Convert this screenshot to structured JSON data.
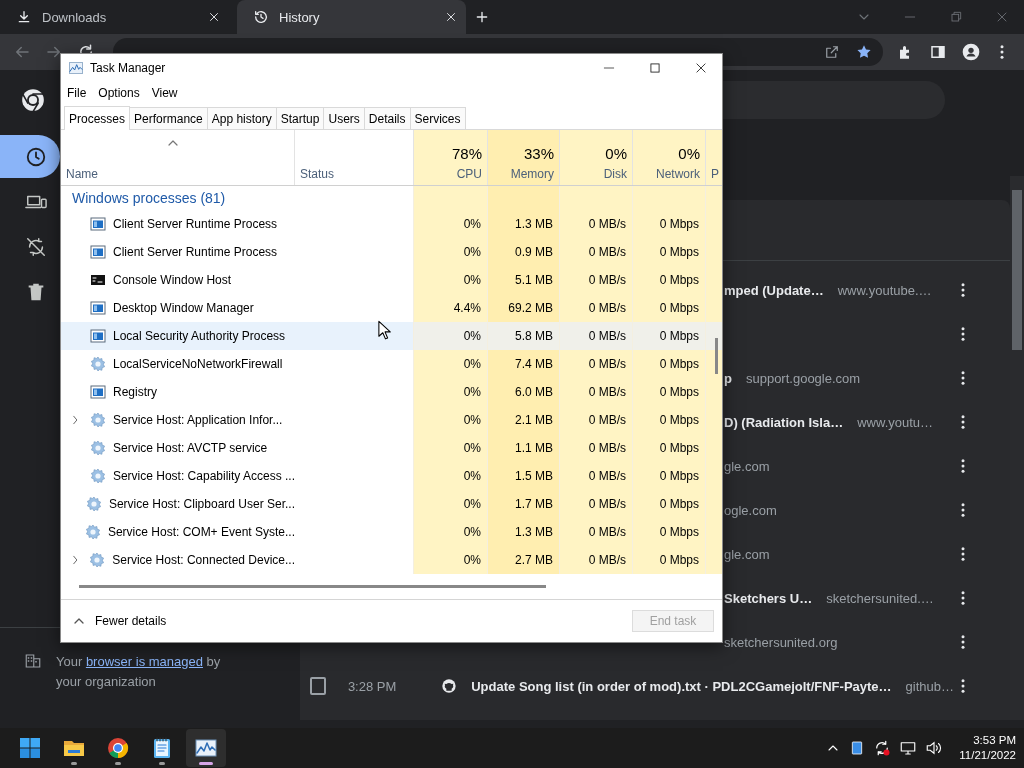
{
  "browser": {
    "tabs": [
      {
        "kind": "download",
        "label": "Downloads",
        "selected": false
      },
      {
        "kind": "history",
        "label": "History",
        "selected": true
      }
    ],
    "sidebar": {
      "items": [
        {
          "kind": "history",
          "selected": true
        },
        {
          "kind": "devices",
          "selected": false
        },
        {
          "kind": "sync-off",
          "selected": false
        },
        {
          "kind": "trash",
          "selected": false
        }
      ],
      "managed_note": {
        "before": "Your",
        "link": "browser is managed",
        "after": "by your organization"
      }
    },
    "history_rows": [
      {
        "title": "mped (Update…",
        "url": "www.youtube.…"
      },
      {},
      {
        "title": "p",
        "url": "support.google.com"
      },
      {
        "title": "D) (Radiation Isla…",
        "url": "www.youtu…"
      },
      {
        "url": "gle.com"
      },
      {
        "url": "ogle.com"
      },
      {
        "url": "gle.com"
      },
      {
        "title": "Sketchers U…",
        "url": "sketchersunited.…"
      },
      {
        "url": "sketchersunited.org"
      },
      {
        "checked": false,
        "time": "3:28 PM",
        "title": "Update Song list (in order of mod).txt · PDL2CGamejolt/FNF-Payte…",
        "url": "github…"
      }
    ]
  },
  "task_manager": {
    "title": "Task Manager",
    "menu": [
      "File",
      "Options",
      "View"
    ],
    "tabs": [
      {
        "label": "Processes",
        "selected": true
      },
      {
        "label": "Performance",
        "selected": false
      },
      {
        "label": "App history",
        "selected": false
      },
      {
        "label": "Startup",
        "selected": false
      },
      {
        "label": "Users",
        "selected": false
      },
      {
        "label": "Details",
        "selected": false
      },
      {
        "label": "Services",
        "selected": false
      }
    ],
    "columns": [
      {
        "label": "Name"
      },
      {
        "label": "Status"
      },
      {
        "label": "CPU",
        "total": "78%"
      },
      {
        "label": "Memory",
        "total": "33%"
      },
      {
        "label": "Disk",
        "total": "0%"
      },
      {
        "label": "Network",
        "total": "0%"
      },
      {
        "label": "P"
      }
    ],
    "group": "Windows processes (81)",
    "processes": [
      {
        "kind": "app",
        "name": "Client Server Runtime Process",
        "expandable": false,
        "selected": false,
        "cpu": "0%",
        "memory": "1.3 MB",
        "disk": "0 MB/s",
        "network": "0 Mbps"
      },
      {
        "kind": "app",
        "name": "Client Server Runtime Process",
        "expandable": false,
        "selected": false,
        "cpu": "0%",
        "memory": "0.9 MB",
        "disk": "0 MB/s",
        "network": "0 Mbps"
      },
      {
        "kind": "console",
        "name": "Console Window Host",
        "expandable": false,
        "selected": false,
        "cpu": "0%",
        "memory": "5.1 MB",
        "disk": "0 MB/s",
        "network": "0 Mbps"
      },
      {
        "kind": "app",
        "name": "Desktop Window Manager",
        "expandable": false,
        "selected": false,
        "cpu": "4.4%",
        "memory": "69.2 MB",
        "disk": "0 MB/s",
        "network": "0 Mbps"
      },
      {
        "kind": "app",
        "name": "Local Security Authority Process",
        "expandable": false,
        "selected": true,
        "cpu": "0%",
        "memory": "5.8 MB",
        "disk": "0 MB/s",
        "network": "0 Mbps"
      },
      {
        "kind": "service",
        "name": "LocalServiceNoNetworkFirewall",
        "expandable": false,
        "selected": false,
        "cpu": "0%",
        "memory": "7.4 MB",
        "disk": "0 MB/s",
        "network": "0 Mbps"
      },
      {
        "kind": "app",
        "name": "Registry",
        "expandable": false,
        "selected": false,
        "cpu": "0%",
        "memory": "6.0 MB",
        "disk": "0 MB/s",
        "network": "0 Mbps"
      },
      {
        "kind": "service",
        "name": "Service Host: Application Infor...",
        "expandable": true,
        "selected": false,
        "cpu": "0%",
        "memory": "2.1 MB",
        "disk": "0 MB/s",
        "network": "0 Mbps"
      },
      {
        "kind": "service",
        "name": "Service Host: AVCTP service",
        "expandable": false,
        "selected": false,
        "cpu": "0%",
        "memory": "1.1 MB",
        "disk": "0 MB/s",
        "network": "0 Mbps"
      },
      {
        "kind": "service",
        "name": "Service Host: Capability Access ...",
        "expandable": false,
        "selected": false,
        "cpu": "0%",
        "memory": "1.5 MB",
        "disk": "0 MB/s",
        "network": "0 Mbps"
      },
      {
        "kind": "service",
        "name": "Service Host: Clipboard User Ser...",
        "expandable": false,
        "selected": false,
        "cpu": "0%",
        "memory": "1.7 MB",
        "disk": "0 MB/s",
        "network": "0 Mbps"
      },
      {
        "kind": "service",
        "name": "Service Host: COM+ Event Syste...",
        "expandable": false,
        "selected": false,
        "cpu": "0%",
        "memory": "1.3 MB",
        "disk": "0 MB/s",
        "network": "0 Mbps"
      },
      {
        "kind": "service",
        "name": "Service Host: Connected Device...",
        "expandable": true,
        "selected": false,
        "cpu": "0%",
        "memory": "2.7 MB",
        "disk": "0 MB/s",
        "network": "0 Mbps"
      }
    ],
    "footer": {
      "toggle": "Fewer details",
      "end_task": {
        "label": "End task",
        "disabled": true
      }
    }
  },
  "taskbar": {
    "apps": [
      {
        "kind": "start",
        "running": false,
        "selected": false
      },
      {
        "kind": "folder",
        "running": true,
        "selected": false
      },
      {
        "kind": "browser",
        "running": true,
        "selected": false
      },
      {
        "kind": "notepad",
        "running": true,
        "selected": false
      },
      {
        "kind": "monitor",
        "running": true,
        "selected": true
      }
    ],
    "time": "3:53 PM",
    "date": "11/21/2022"
  }
}
